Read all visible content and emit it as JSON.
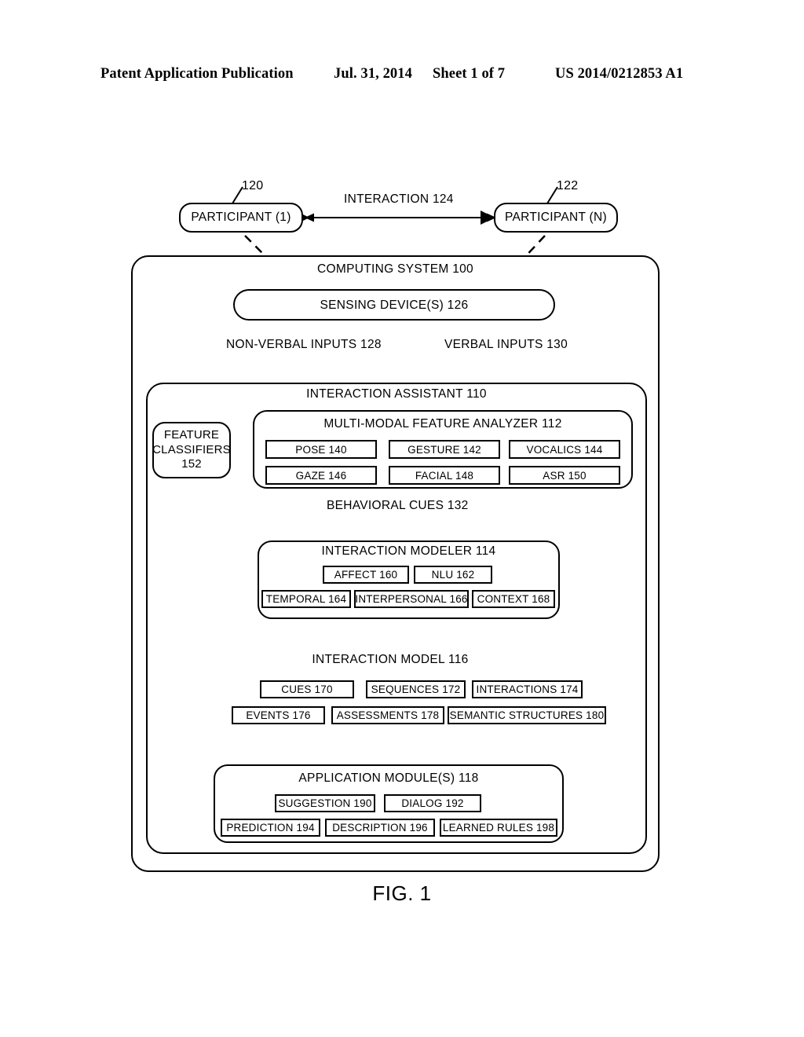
{
  "page_header": {
    "title": "Patent Application Publication",
    "date": "Jul. 31, 2014",
    "sheet": "Sheet 1 of 7",
    "publication_number": "US 2014/0212853 A1"
  },
  "figure": {
    "caption": "FIG. 1"
  },
  "participants": {
    "left": {
      "label": "PARTICIPANT (1)",
      "ref": "120"
    },
    "right": {
      "label": "PARTICIPANT (N)",
      "ref": "122"
    },
    "interaction_label": "INTERACTION 124"
  },
  "computing_system": {
    "title": "COMPUTING SYSTEM 100",
    "sensing_devices": "SENSING DEVICE(S) 126",
    "inputs": {
      "non_verbal": "NON-VERBAL INPUTS 128",
      "verbal": "VERBAL INPUTS 130"
    }
  },
  "interaction_assistant": {
    "title": "INTERACTION ASSISTANT 110",
    "feature_classifiers": {
      "line1": "FEATURE",
      "line2": "CLASSIFIERS",
      "line3": "152"
    },
    "feature_analyzer": {
      "title": "MULTI-MODAL FEATURE ANALYZER 112",
      "rows": [
        [
          "POSE 140",
          "GESTURE 142",
          "VOCALICS 144"
        ],
        [
          "GAZE 146",
          "FACIAL 148",
          "ASR 150"
        ]
      ]
    },
    "behavioral_cues": "BEHAVIORAL CUES 132",
    "interaction_modeler": {
      "title": "INTERACTION MODELER 114",
      "row1": [
        "AFFECT 160",
        "NLU 162"
      ],
      "row2": [
        "TEMPORAL 164",
        "INTERPERSONAL 166",
        "CONTEXT 168"
      ]
    },
    "interaction_model": {
      "title": "INTERACTION MODEL 116",
      "row1": [
        "CUES 170",
        "SEQUENCES 172",
        "INTERACTIONS 174"
      ],
      "row2": [
        "EVENTS 176",
        "ASSESSMENTS 178",
        "SEMANTIC STRUCTURES 180"
      ]
    },
    "application_modules": {
      "title": "APPLICATION MODULE(S) 118",
      "row1": [
        "SUGGESTION 190",
        "DIALOG 192"
      ],
      "row2": [
        "PREDICTION 194",
        "DESCRIPTION 196",
        "LEARNED RULES 198"
      ]
    }
  },
  "colors": {
    "ink": "#000000",
    "paper": "#ffffff"
  }
}
